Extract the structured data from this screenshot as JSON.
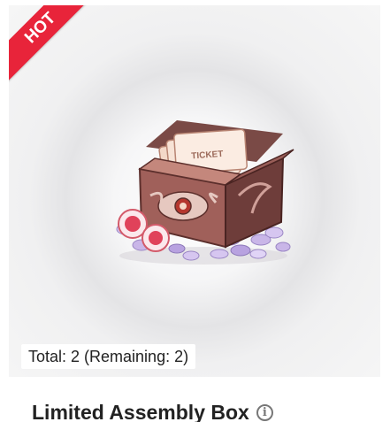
{
  "badge": {
    "label": "HOT",
    "color": "#e8243a"
  },
  "product": {
    "image_icon": "treasure-chest-image",
    "total_text": "Total: 2 (Remaining: 2)",
    "title": "Limited Assembly Box",
    "info_icon": "info-icon",
    "ticket_text": "TICKET"
  }
}
